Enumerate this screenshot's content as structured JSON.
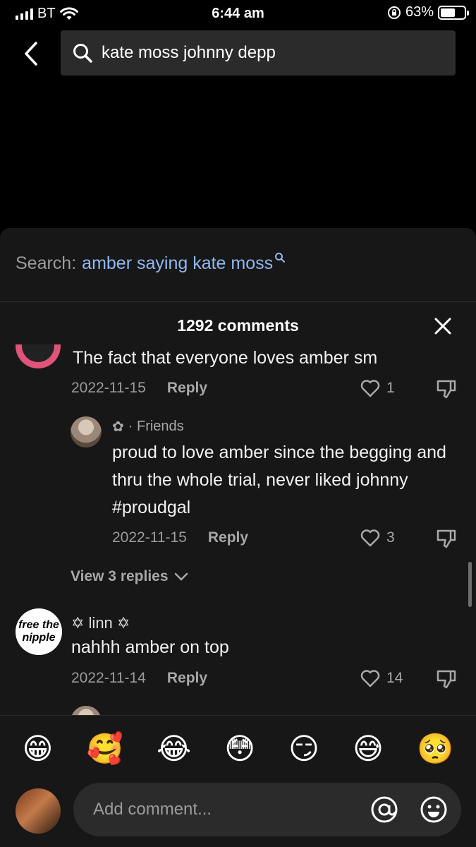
{
  "status_bar": {
    "carrier": "BT",
    "time": "6:44 am",
    "battery": "63%",
    "battery_level": 0.63
  },
  "search": {
    "query": "kate moss johnny depp"
  },
  "sheet": {
    "suggestion_label": "Search:",
    "suggestion_term": "amber saying kate moss",
    "comments_count": "1292 comments"
  },
  "comments": [
    {
      "text": "The fact that everyone loves amber sm",
      "date": "2022-11-15",
      "reply": "Reply",
      "likes": "1"
    },
    {
      "user": "✿",
      "badge": "· Friends",
      "text": "proud to love amber since the begging and thru the whole trial, never liked johnny #proudgal",
      "date": "2022-11-15",
      "reply": "Reply",
      "likes": "3"
    },
    {
      "user": "✡ linn ✡",
      "text": "nahhh amber on top",
      "date": "2022-11-14",
      "reply": "Reply",
      "likes": "14",
      "avatar_text": "free the nipple"
    }
  ],
  "view_replies": "View 3 replies",
  "emojis": [
    "😁",
    "🥰",
    "😂",
    "😳",
    "😏",
    "😅",
    "🥺"
  ],
  "input": {
    "placeholder": "Add comment..."
  },
  "icons": {
    "back": "chevron-left-icon",
    "search": "search-icon",
    "close": "close-icon",
    "heart": "heart-icon",
    "dislike": "thumbs-down-icon",
    "at": "at-icon",
    "emoji": "emoji-icon"
  }
}
